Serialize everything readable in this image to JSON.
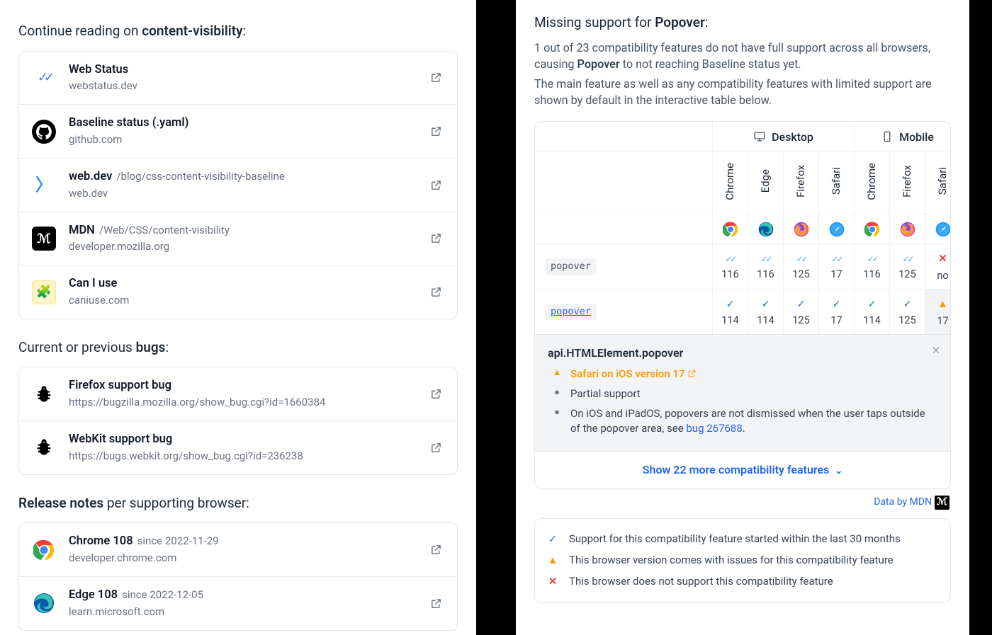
{
  "left": {
    "continue": {
      "heading_prefix": "Continue reading on ",
      "heading_bold": "content-visibility",
      "heading_suffix": ":",
      "items": [
        {
          "icon": "webstatus",
          "title": "Web Status",
          "path": "",
          "sub": "webstatus.dev"
        },
        {
          "icon": "github",
          "title": "Baseline status (.yaml)",
          "path": "",
          "sub": "github.com"
        },
        {
          "icon": "webdev",
          "title": "web.dev",
          "path": "/blog/css-content-visibility-baseline",
          "sub": "web.dev"
        },
        {
          "icon": "mdn",
          "title": "MDN",
          "path": "/Web/CSS/content-visibility",
          "sub": "developer.mozilla.org"
        },
        {
          "icon": "caniuse",
          "title": "Can I use",
          "path": "",
          "sub": "caniuse.com"
        }
      ]
    },
    "bugs": {
      "heading_prefix": "Current or previous ",
      "heading_bold": "bugs",
      "heading_suffix": ":",
      "items": [
        {
          "icon": "bug",
          "title": "Firefox support bug",
          "path": "",
          "sub": "https://bugzilla.mozilla.org/show_bug.cgi?id=1660384"
        },
        {
          "icon": "bug",
          "title": "WebKit support bug",
          "path": "",
          "sub": "https://bugs.webkit.org/show_bug.cgi?id=236238"
        }
      ]
    },
    "releases": {
      "heading_bold": "Release notes",
      "heading_suffix": " per supporting browser:",
      "items": [
        {
          "icon": "chrome",
          "title": "Chrome 108",
          "path": "since 2022-11-29",
          "sub": "developer.chrome.com"
        },
        {
          "icon": "edge",
          "title": "Edge 108",
          "path": "since 2022-12-05",
          "sub": "learn.microsoft.com"
        }
      ]
    }
  },
  "right": {
    "lead_prefix": "Missing support for ",
    "lead_bold": "Popover",
    "lead_suffix": ":",
    "para1_a": "1 out of 23 compatibility features do not have full support across all browsers, causing ",
    "para1_b": "Popover",
    "para1_c": " to not reaching Baseline status yet.",
    "para2": "The main feature as well as any compatibility features with limited support are shown by default in the interactive table below.",
    "table": {
      "groups": [
        {
          "label": "Desktop",
          "icon": "desktop-icon",
          "span": 4
        },
        {
          "label": "Mobile",
          "icon": "mobile-icon",
          "span": 3
        }
      ],
      "browsers": [
        {
          "name": "Chrome",
          "icon": "chrome"
        },
        {
          "name": "Edge",
          "icon": "edge"
        },
        {
          "name": "Firefox",
          "icon": "firefox"
        },
        {
          "name": "Safari",
          "icon": "safari"
        },
        {
          "name": "Chrome",
          "icon": "chrome"
        },
        {
          "name": "Firefox",
          "icon": "firefox"
        },
        {
          "name": "Safari",
          "icon": "safari"
        }
      ],
      "rows": [
        {
          "label": "popover",
          "link": false,
          "cells": [
            {
              "mark": "chk2",
              "v": "116"
            },
            {
              "mark": "chk2",
              "v": "116"
            },
            {
              "mark": "chk2",
              "v": "125"
            },
            {
              "mark": "chk2",
              "v": "17"
            },
            {
              "mark": "chk2",
              "v": "116"
            },
            {
              "mark": "chk2",
              "v": "125"
            },
            {
              "mark": "x",
              "v": "no"
            }
          ]
        },
        {
          "label": "popover",
          "link": true,
          "cells": [
            {
              "mark": "chk",
              "v": "114"
            },
            {
              "mark": "chk",
              "v": "114"
            },
            {
              "mark": "chk",
              "v": "125"
            },
            {
              "mark": "chk",
              "v": "17"
            },
            {
              "mark": "chk",
              "v": "114"
            },
            {
              "mark": "chk",
              "v": "125"
            },
            {
              "mark": "warn",
              "v": "17"
            }
          ]
        }
      ]
    },
    "detail": {
      "title": "api.HTMLElement.popover",
      "safari_label": "Safari on iOS version 17",
      "partial_label": "Partial support",
      "note_a": "On iOS and iPadOS, popovers are not dismissed when the user taps outside of the popover area, see ",
      "bug_link": "bug 267688",
      "note_b": "."
    },
    "show_more": "Show 22 more compatibility features",
    "data_by": "Data by MDN",
    "legend": [
      {
        "mark": "chk",
        "text": "Support for this compatibility feature started within the last 30 months"
      },
      {
        "mark": "warn",
        "text": "This browser version comes with issues for this compatibility feature"
      },
      {
        "mark": "x",
        "text": "This browser does not support this compatibility feature"
      }
    ]
  }
}
